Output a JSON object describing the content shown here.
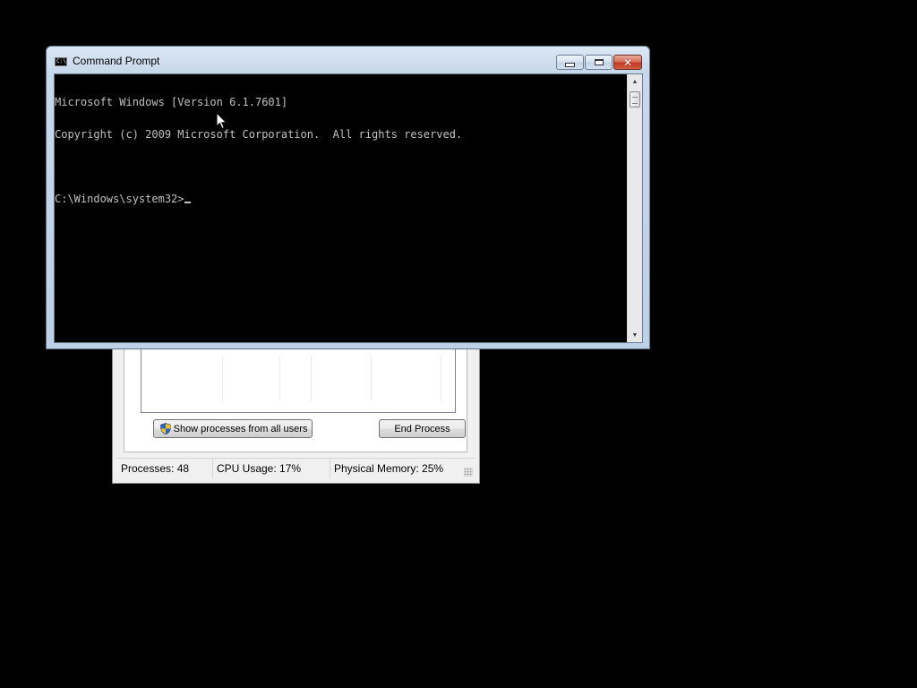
{
  "command_prompt": {
    "title": "Command Prompt",
    "icon_name": "console-icon",
    "icon_glyph": "C:\\.",
    "lines": [
      "Microsoft Windows [Version 6.1.7601]",
      "Copyright (c) 2009 Microsoft Corporation.  All rights reserved.",
      "",
      "C:\\Windows\\system32>"
    ],
    "caption_buttons": {
      "minimize_icon": "minimize-icon",
      "maximize_icon": "maximize-icon",
      "close_icon": "close-icon",
      "close_glyph": "✕"
    },
    "scrollbar": {
      "up_glyph": "▲",
      "down_glyph": "▼"
    }
  },
  "task_manager": {
    "buttons": {
      "show_all_label": "Show processes from all users",
      "end_process_label": "End Process"
    },
    "status_bar": {
      "processes": "Processes: 48",
      "cpu_usage": "CPU Usage: 17%",
      "physical_memory": "Physical Memory: 25%"
    }
  },
  "colors": {
    "desktop": "#000000",
    "console_bg": "#000000",
    "console_fg": "#c0c0c0",
    "close_button": "#c13b25"
  }
}
